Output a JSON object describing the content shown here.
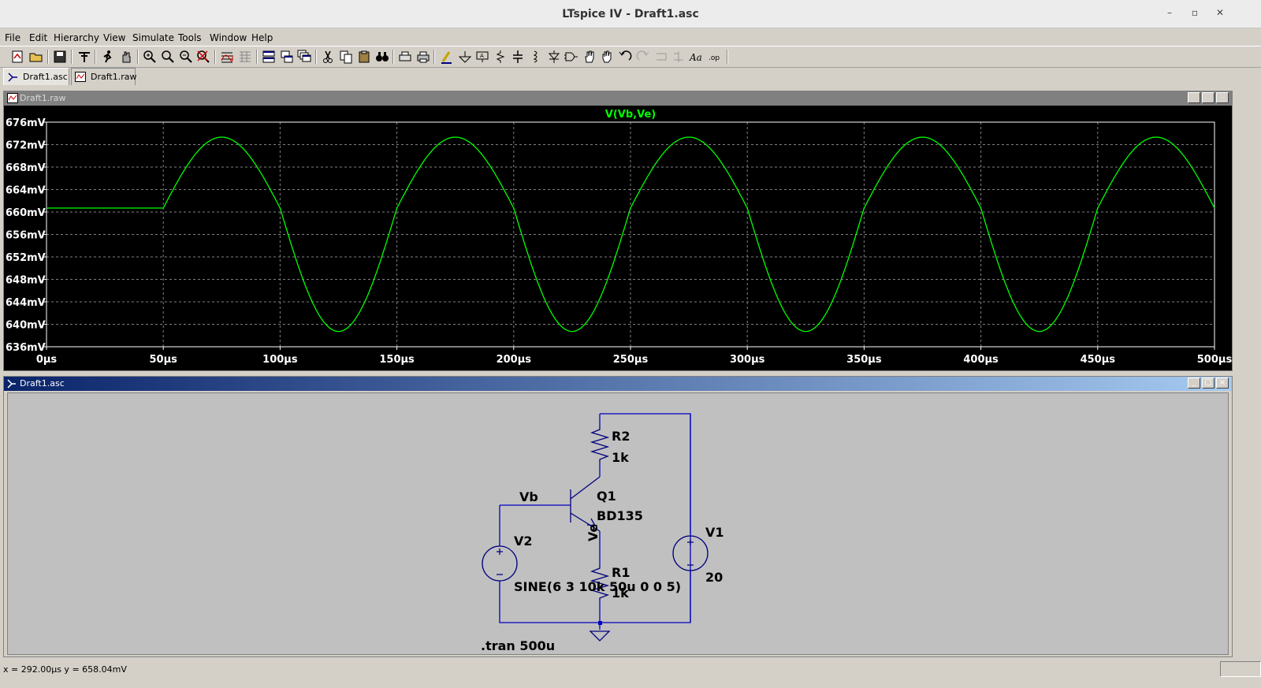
{
  "window": {
    "title": "LTspice IV - Draft1.asc",
    "min": "–",
    "restore": "▫",
    "close": "✕"
  },
  "menu": [
    "File",
    "Edit",
    "Hierarchy",
    "View",
    "Simulate",
    "Tools",
    "Window",
    "Help"
  ],
  "toolbar_icons": [
    "new-schematic-icon",
    "open-icon",
    "save-icon",
    "control-panel-icon",
    "run-icon",
    "halt-icon",
    "zoom-in-icon",
    "zoom-pan-icon",
    "zoom-out-icon",
    "zoom-cancel-icon",
    "autorange-icon",
    "grid-icon",
    "tile-horizontal-icon",
    "tile-vertical-icon",
    "cascade-icon",
    "cut-icon",
    "copy-icon",
    "paste-icon",
    "find-icon",
    "print-setup-icon",
    "print-icon",
    "draw-wire-icon",
    "ground-icon",
    "label-net-icon",
    "resistor-icon",
    "capacitor-icon",
    "inductor-icon",
    "diode-icon",
    "component-icon",
    "move-icon",
    "drag-icon",
    "undo-icon",
    "redo-icon",
    "rotate-icon",
    "mirror-icon",
    "text-icon",
    "spice-directive-icon"
  ],
  "tabs": [
    {
      "label": "Draft1.asc",
      "icon": "schematic-icon",
      "active": true
    },
    {
      "label": "Draft1.raw",
      "icon": "waveform-icon",
      "active": false
    }
  ],
  "plot_window": {
    "title": "Draft1.raw",
    "trace_label": "V(Vb,Ve)",
    "trace_color": "#00ff00",
    "y_ticks": [
      "676mV",
      "672mV",
      "668mV",
      "664mV",
      "660mV",
      "656mV",
      "652mV",
      "648mV",
      "644mV",
      "640mV",
      "636mV"
    ],
    "x_ticks": [
      "0µs",
      "50µs",
      "100µs",
      "150µs",
      "200µs",
      "250µs",
      "300µs",
      "350µs",
      "400µs",
      "450µs",
      "500µs"
    ]
  },
  "chart_data": {
    "type": "line",
    "title": "",
    "xlabel": "",
    "ylabel": "",
    "xlim": [
      0,
      500
    ],
    "ylim": [
      636,
      676
    ],
    "x_unit": "µs",
    "y_unit": "mV",
    "grid": true,
    "series": [
      {
        "name": "V(Vb,Ve)",
        "color": "#00ff00",
        "baseline_mV": 660.7,
        "delay_us": 50,
        "amplitude_mV": 17.3,
        "offset_mV": 656.0,
        "freq_kHz": 10,
        "x": [
          0,
          50,
          75,
          100,
          125,
          150,
          175,
          200,
          225,
          250,
          275,
          300,
          325,
          350,
          375,
          400,
          425,
          450,
          475,
          500
        ],
        "y": [
          660.7,
          660.7,
          673.3,
          660.2,
          638.7,
          660.2,
          673.3,
          660.2,
          638.7,
          660.2,
          673.3,
          660.2,
          638.7,
          660.2,
          673.3,
          660.2,
          638.7,
          660.2,
          673.3,
          661.0
        ]
      }
    ]
  },
  "schematic_window": {
    "title": "Draft1.asc",
    "labels": {
      "r2_name": "R2",
      "r2_value": "1k",
      "q1_name": "Q1",
      "q1_model": "BD135",
      "vb": "Vb",
      "ve": "Ve",
      "v2_name": "V2",
      "v2_value": "SINE(6 3 10k 50u 0 0 5)",
      "r1_name": "R1",
      "r1_value": "1k",
      "v1_name": "V1",
      "v1_value": "20",
      "directive": ".tran 500u"
    },
    "wire_color": "#0000c0",
    "component_color": "#000080"
  },
  "status": {
    "text": "x = 292.00µs    y = 658.04mV"
  }
}
